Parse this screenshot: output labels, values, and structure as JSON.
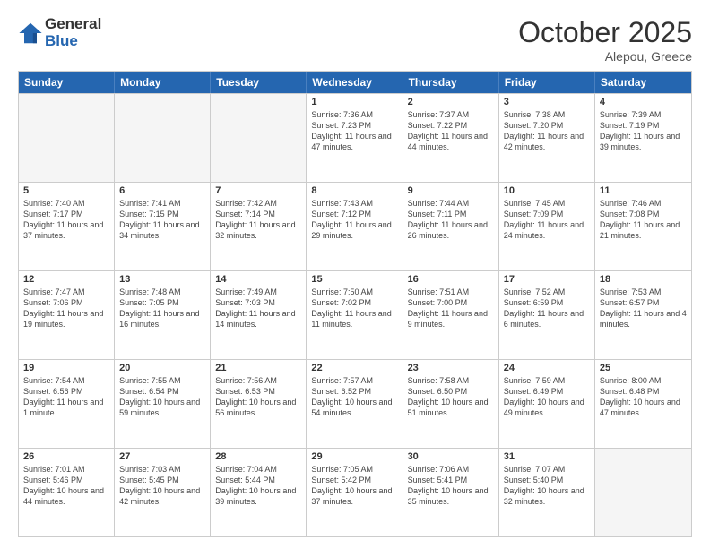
{
  "logo": {
    "general": "General",
    "blue": "Blue"
  },
  "title": "October 2025",
  "location": "Alepou, Greece",
  "days_of_week": [
    "Sunday",
    "Monday",
    "Tuesday",
    "Wednesday",
    "Thursday",
    "Friday",
    "Saturday"
  ],
  "weeks": [
    [
      {
        "day": "",
        "info": ""
      },
      {
        "day": "",
        "info": ""
      },
      {
        "day": "",
        "info": ""
      },
      {
        "day": "1",
        "info": "Sunrise: 7:36 AM\nSunset: 7:23 PM\nDaylight: 11 hours and 47 minutes."
      },
      {
        "day": "2",
        "info": "Sunrise: 7:37 AM\nSunset: 7:22 PM\nDaylight: 11 hours and 44 minutes."
      },
      {
        "day": "3",
        "info": "Sunrise: 7:38 AM\nSunset: 7:20 PM\nDaylight: 11 hours and 42 minutes."
      },
      {
        "day": "4",
        "info": "Sunrise: 7:39 AM\nSunset: 7:19 PM\nDaylight: 11 hours and 39 minutes."
      }
    ],
    [
      {
        "day": "5",
        "info": "Sunrise: 7:40 AM\nSunset: 7:17 PM\nDaylight: 11 hours and 37 minutes."
      },
      {
        "day": "6",
        "info": "Sunrise: 7:41 AM\nSunset: 7:15 PM\nDaylight: 11 hours and 34 minutes."
      },
      {
        "day": "7",
        "info": "Sunrise: 7:42 AM\nSunset: 7:14 PM\nDaylight: 11 hours and 32 minutes."
      },
      {
        "day": "8",
        "info": "Sunrise: 7:43 AM\nSunset: 7:12 PM\nDaylight: 11 hours and 29 minutes."
      },
      {
        "day": "9",
        "info": "Sunrise: 7:44 AM\nSunset: 7:11 PM\nDaylight: 11 hours and 26 minutes."
      },
      {
        "day": "10",
        "info": "Sunrise: 7:45 AM\nSunset: 7:09 PM\nDaylight: 11 hours and 24 minutes."
      },
      {
        "day": "11",
        "info": "Sunrise: 7:46 AM\nSunset: 7:08 PM\nDaylight: 11 hours and 21 minutes."
      }
    ],
    [
      {
        "day": "12",
        "info": "Sunrise: 7:47 AM\nSunset: 7:06 PM\nDaylight: 11 hours and 19 minutes."
      },
      {
        "day": "13",
        "info": "Sunrise: 7:48 AM\nSunset: 7:05 PM\nDaylight: 11 hours and 16 minutes."
      },
      {
        "day": "14",
        "info": "Sunrise: 7:49 AM\nSunset: 7:03 PM\nDaylight: 11 hours and 14 minutes."
      },
      {
        "day": "15",
        "info": "Sunrise: 7:50 AM\nSunset: 7:02 PM\nDaylight: 11 hours and 11 minutes."
      },
      {
        "day": "16",
        "info": "Sunrise: 7:51 AM\nSunset: 7:00 PM\nDaylight: 11 hours and 9 minutes."
      },
      {
        "day": "17",
        "info": "Sunrise: 7:52 AM\nSunset: 6:59 PM\nDaylight: 11 hours and 6 minutes."
      },
      {
        "day": "18",
        "info": "Sunrise: 7:53 AM\nSunset: 6:57 PM\nDaylight: 11 hours and 4 minutes."
      }
    ],
    [
      {
        "day": "19",
        "info": "Sunrise: 7:54 AM\nSunset: 6:56 PM\nDaylight: 11 hours and 1 minute."
      },
      {
        "day": "20",
        "info": "Sunrise: 7:55 AM\nSunset: 6:54 PM\nDaylight: 10 hours and 59 minutes."
      },
      {
        "day": "21",
        "info": "Sunrise: 7:56 AM\nSunset: 6:53 PM\nDaylight: 10 hours and 56 minutes."
      },
      {
        "day": "22",
        "info": "Sunrise: 7:57 AM\nSunset: 6:52 PM\nDaylight: 10 hours and 54 minutes."
      },
      {
        "day": "23",
        "info": "Sunrise: 7:58 AM\nSunset: 6:50 PM\nDaylight: 10 hours and 51 minutes."
      },
      {
        "day": "24",
        "info": "Sunrise: 7:59 AM\nSunset: 6:49 PM\nDaylight: 10 hours and 49 minutes."
      },
      {
        "day": "25",
        "info": "Sunrise: 8:00 AM\nSunset: 6:48 PM\nDaylight: 10 hours and 47 minutes."
      }
    ],
    [
      {
        "day": "26",
        "info": "Sunrise: 7:01 AM\nSunset: 5:46 PM\nDaylight: 10 hours and 44 minutes."
      },
      {
        "day": "27",
        "info": "Sunrise: 7:03 AM\nSunset: 5:45 PM\nDaylight: 10 hours and 42 minutes."
      },
      {
        "day": "28",
        "info": "Sunrise: 7:04 AM\nSunset: 5:44 PM\nDaylight: 10 hours and 39 minutes."
      },
      {
        "day": "29",
        "info": "Sunrise: 7:05 AM\nSunset: 5:42 PM\nDaylight: 10 hours and 37 minutes."
      },
      {
        "day": "30",
        "info": "Sunrise: 7:06 AM\nSunset: 5:41 PM\nDaylight: 10 hours and 35 minutes."
      },
      {
        "day": "31",
        "info": "Sunrise: 7:07 AM\nSunset: 5:40 PM\nDaylight: 10 hours and 32 minutes."
      },
      {
        "day": "",
        "info": ""
      }
    ]
  ]
}
